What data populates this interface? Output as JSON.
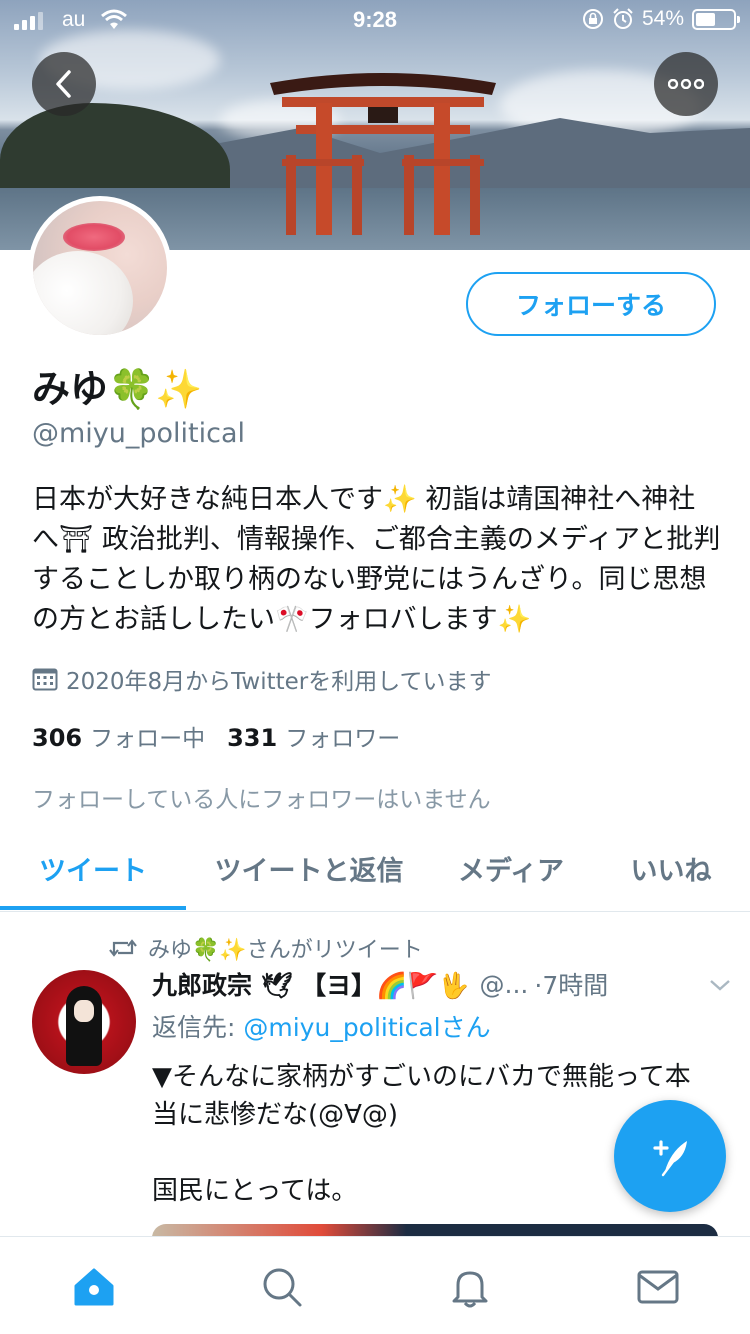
{
  "status_bar": {
    "carrier": "au",
    "time": "9:28",
    "battery_percent": "54%",
    "battery_level": 0.54
  },
  "header": {
    "back_icon": "chevron-left-icon",
    "more_icon": "more-horizontal-icon"
  },
  "profile": {
    "display_name": "みゆ🍀✨",
    "handle": "@miyu_political",
    "follow_button": "フォローする",
    "bio": "日本が大好きな純日本人です✨ 初詣は靖国神社へ神社へ⛩ 政治批判、情報操作、ご都合主義のメディアと批判することしか取り柄のない野党にはうんざり。同じ思想の方とお話ししたい🎌フォロバします✨",
    "joined": "2020年8月からTwitterを利用しています",
    "following_count": "306",
    "following_label": "フォロー中",
    "followers_count": "331",
    "followers_label": "フォロワー",
    "mutual_note": "フォローしている人にフォロワーはいません"
  },
  "tabs": [
    {
      "label": "ツイート",
      "active": true
    },
    {
      "label": "ツイートと返信",
      "active": false
    },
    {
      "label": "メディア",
      "active": false
    },
    {
      "label": "いいね",
      "active": false
    }
  ],
  "tweet": {
    "retweet_note": "みゆ🍀✨さんがリツイート",
    "author_name": "九郎政宗 🕊 【ヨ】🌈🚩🖖",
    "author_handle": "@...",
    "time": "·7時間",
    "reply_to_prefix": "返信先: ",
    "reply_to_handle": "@miyu_politicalさん",
    "text": "▼そんなに家柄がすごいのにバカで無能って本当に悲惨だな(@∀@)\n\n国民にとっては。"
  },
  "colors": {
    "accent": "#1da1f2",
    "secondary_text": "#657786",
    "primary_text": "#14171a"
  },
  "bottom_nav": [
    {
      "name": "home",
      "icon": "home-icon",
      "active": true
    },
    {
      "name": "search",
      "icon": "search-icon",
      "active": false
    },
    {
      "name": "notifications",
      "icon": "bell-icon",
      "active": false
    },
    {
      "name": "messages",
      "icon": "mail-icon",
      "active": false
    }
  ]
}
